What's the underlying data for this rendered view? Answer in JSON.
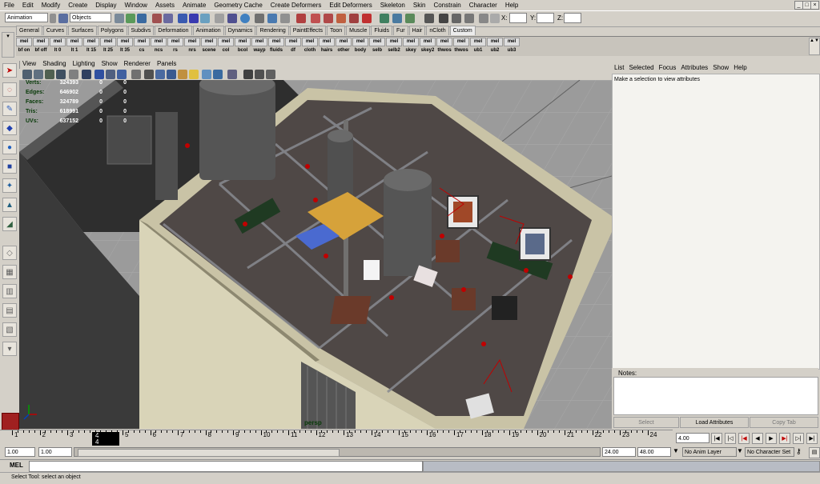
{
  "menu": [
    "File",
    "Edit",
    "Modify",
    "Create",
    "Display",
    "Window",
    "Assets",
    "Animate",
    "Geometry Cache",
    "Create Deformers",
    "Edit Deformers",
    "Skeleton",
    "Skin",
    "Constrain",
    "Character",
    "Help"
  ],
  "status_line": {
    "menuset": "Animation",
    "selection_mask": "Objects",
    "x_label": "X:",
    "y_label": "Y:",
    "z_label": "Z:"
  },
  "shelf_tabs": [
    "General",
    "Curves",
    "Surfaces",
    "Polygons",
    "Subdivs",
    "Deformation",
    "Animation",
    "Dynamics",
    "Rendering",
    "PaintEffects",
    "Toon",
    "Muscle",
    "Fluids",
    "Fur",
    "Hair",
    "nCloth",
    "Custom"
  ],
  "shelf_active": "Custom",
  "shelf_items": [
    "bf on",
    "bf off",
    "lt 0",
    "lt 1",
    "lt 15",
    "lt 25",
    "lt 35",
    "cs",
    "ncs",
    "rs",
    "nrs",
    "scene",
    "col",
    "bcol",
    "wayp",
    "fluids",
    "df",
    "cloth",
    "hairs",
    "other",
    "body",
    "selb",
    "selb2",
    "skey",
    "skey2",
    "thwos",
    "thwos",
    "ub1",
    "ub2",
    "ub3"
  ],
  "shelf_icon_word": "mel",
  "panel_menu": [
    "View",
    "Shading",
    "Lighting",
    "Show",
    "Renderer",
    "Panels"
  ],
  "hud": [
    {
      "label": "Verts:",
      "value": "324393",
      "a": "0",
      "b": "0"
    },
    {
      "label": "Edges:",
      "value": "646902",
      "a": "0",
      "b": "0"
    },
    {
      "label": "Faces:",
      "value": "324789",
      "a": "0",
      "b": "0"
    },
    {
      "label": "Tris:",
      "value": "618991",
      "a": "0",
      "b": "0"
    },
    {
      "label": "UVs:",
      "value": "637152",
      "a": "0",
      "b": "0"
    }
  ],
  "camera_label": "persp",
  "attribute_editor": {
    "menu": [
      "List",
      "Selected",
      "Focus",
      "Attributes",
      "Show",
      "Help"
    ],
    "message": "Make a selection to view attributes",
    "notes_label": "Notes:",
    "buttons": {
      "select": "Select",
      "load": "Load Attributes",
      "copy": "Copy Tab"
    }
  },
  "timeline": {
    "ticks": [
      "1",
      "2",
      "3",
      "4",
      "5",
      "6",
      "7",
      "8",
      "9",
      "10",
      "11",
      "12",
      "13",
      "14",
      "15",
      "16",
      "17",
      "18",
      "19",
      "20",
      "21",
      "22",
      "23",
      "24"
    ],
    "current_frame_marker": "4",
    "current_frame_field": "4.00"
  },
  "range": {
    "start": "1.00",
    "inner_start": "1.00",
    "inner_end": "24.00",
    "end": "48.00",
    "anim_layer": "No Anim Layer",
    "character_set": "No Character Set"
  },
  "mel_label": "MEL",
  "help_line": "Select Tool: select an object",
  "colors": {
    "accent_red": "#c00000",
    "hud_green": "#083a08",
    "viewport_bg": "#9b9b9b"
  }
}
